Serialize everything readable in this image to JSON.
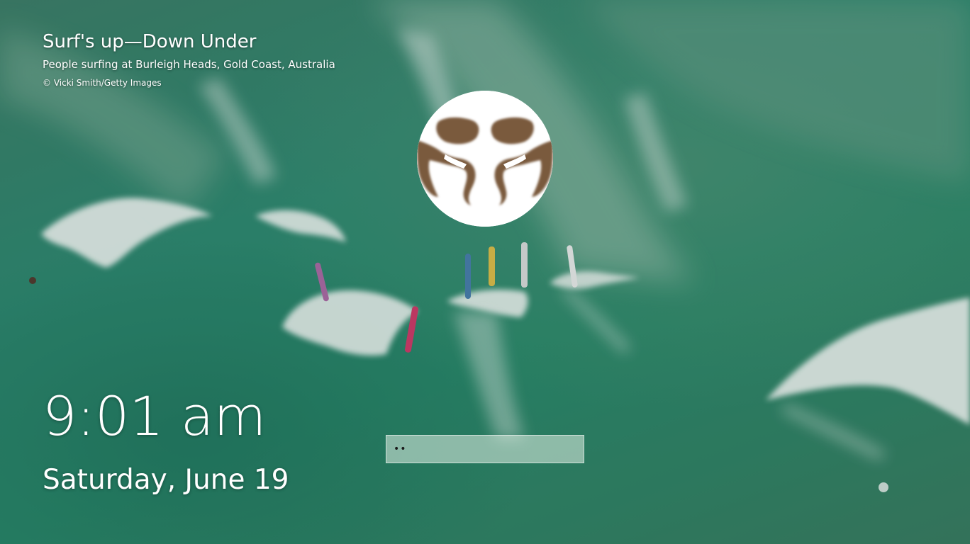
{
  "spotlight": {
    "title": "Surf's up—Down Under",
    "subtitle": "People surfing at Burleigh Heads, Gold Coast, Australia",
    "credit": "© Vicki Smith/Getty Images"
  },
  "user": {
    "avatar_icon": "user-avatar-icon"
  },
  "lock": {
    "time": "9:01 am",
    "date": "Saturday, June 19"
  },
  "password": {
    "value": "••",
    "type": "password"
  },
  "colors": {
    "water": "#2f8a72",
    "foam": "#ffffff",
    "text": "#ffffff"
  }
}
